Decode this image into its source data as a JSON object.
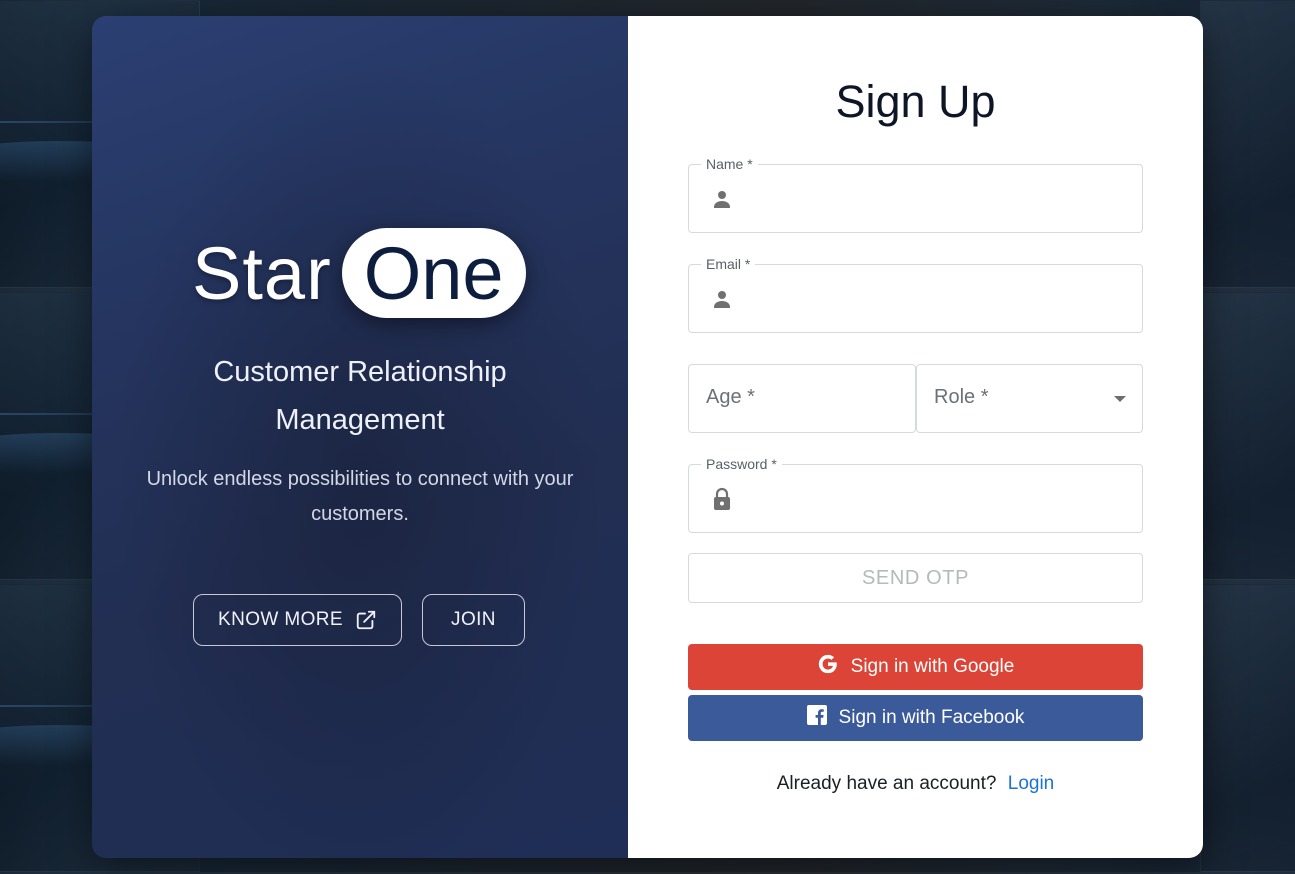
{
  "brand": {
    "star": "Star",
    "one": "One",
    "subtitle_line1": "Customer Relationship",
    "subtitle_line2": "Management",
    "tagline": "Unlock endless possibilities to connect with your customers.",
    "know_more_label": "KNOW MORE",
    "join_label": "JOIN"
  },
  "form": {
    "title": "Sign Up",
    "name_label": "Name *",
    "email_label": "Email *",
    "age_placeholder": "Age *",
    "role_placeholder": "Role *",
    "password_label": "Password *",
    "send_otp_label": "SEND OTP",
    "google_label": "Sign in with Google",
    "facebook_label": "Sign in with Facebook",
    "footer_text": "Already have an account?",
    "login_link": "Login"
  },
  "icons": {
    "name": "person-icon",
    "email": "person-icon",
    "password": "lock-icon",
    "role": "caret-down-icon",
    "know_more": "external-link-icon",
    "google": "google-icon",
    "facebook": "facebook-icon"
  },
  "colors": {
    "left_panel": "#253560",
    "google": "#dc4437",
    "facebook": "#3b5a9a",
    "link": "#1a73d9",
    "brand_pill": "#ffffff"
  }
}
